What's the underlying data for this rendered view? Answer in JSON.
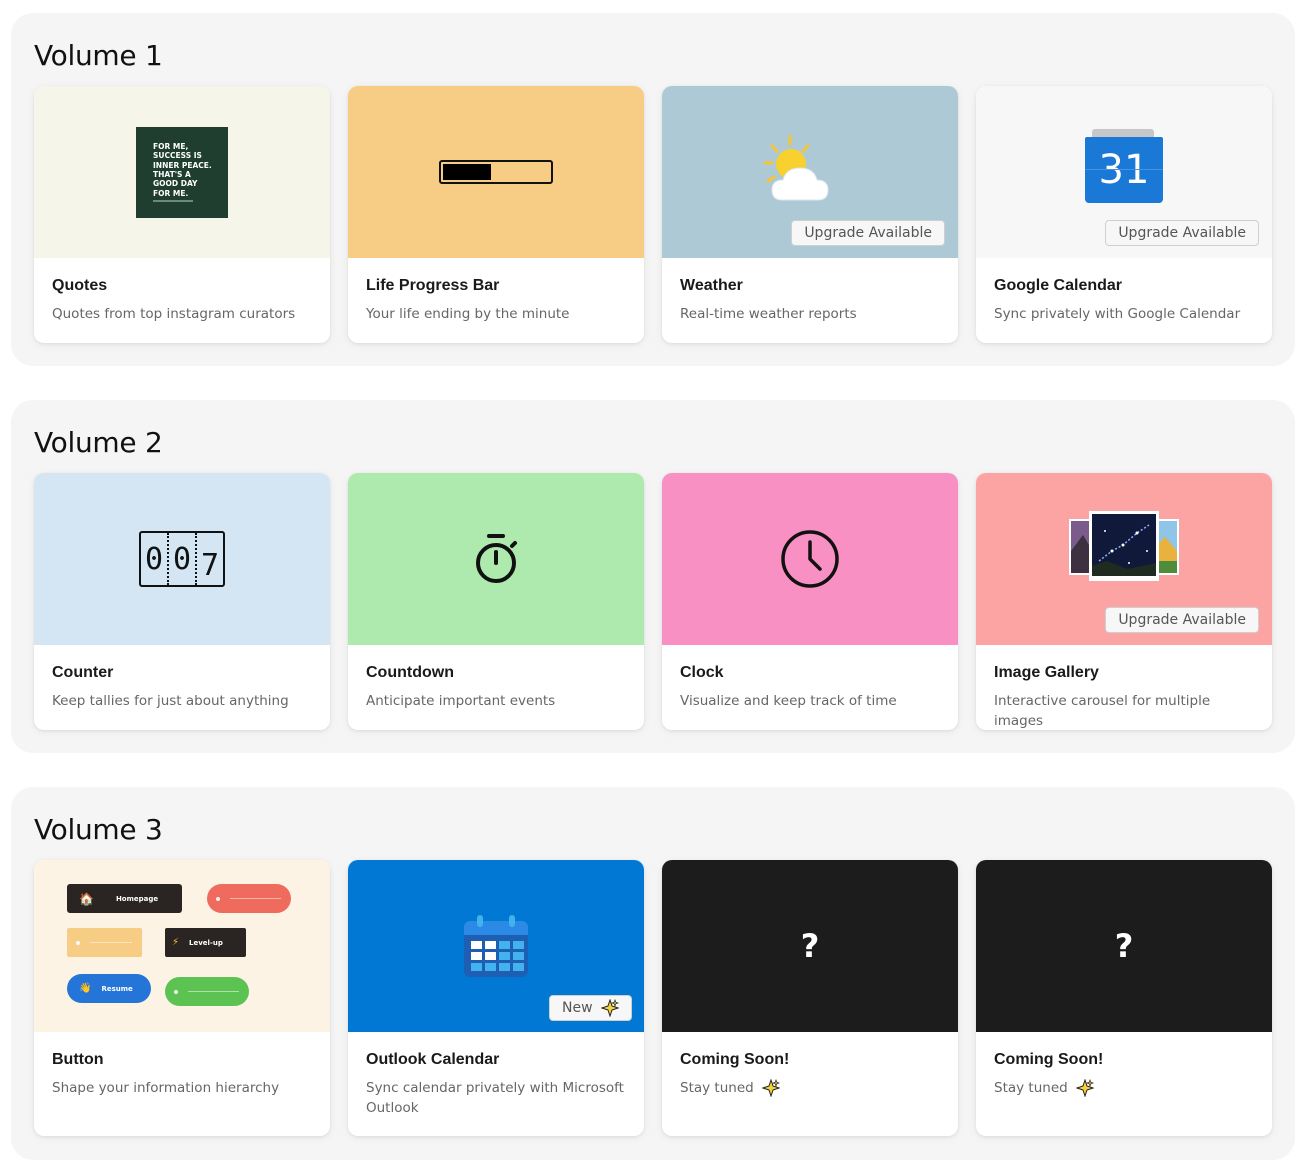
{
  "volumes": [
    {
      "title": "Volume 1",
      "cards": [
        {
          "title": "Quotes",
          "desc": "Quotes from top instagram curators",
          "quote_text": "FOR ME,\nSUCCESS IS\nINNER PEACE.\nTHAT'S A\nGOOD DAY\nFOR ME.",
          "thumb_bg": "#f5f5ea"
        },
        {
          "title": "Life Progress Bar",
          "desc": "Your life ending by the minute",
          "progress": 0.45,
          "thumb_bg": "#f7cd86"
        },
        {
          "title": "Weather",
          "desc": "Real-time weather reports",
          "badge": "Upgrade Available",
          "thumb_bg": "#aec9d6"
        },
        {
          "title": "Google Calendar",
          "desc": "Sync privately with Google Calendar",
          "badge": "Upgrade Available",
          "calendar_day": "31",
          "thumb_bg": "#f7f7f7"
        }
      ]
    },
    {
      "title": "Volume 2",
      "cards": [
        {
          "title": "Counter",
          "desc": "Keep tallies for just about anything",
          "digits": [
            "0",
            "0",
            "7"
          ],
          "thumb_bg": "#d4e6f3"
        },
        {
          "title": "Countdown",
          "desc": "Anticipate important events",
          "thumb_bg": "#aeeaae"
        },
        {
          "title": "Clock",
          "desc": "Visualize and keep track of time",
          "thumb_bg": "#f890c4"
        },
        {
          "title": "Image Gallery",
          "desc": "Interactive carousel for multiple images",
          "badge": "Upgrade Available",
          "thumb_bg": "#fca3a3"
        }
      ]
    },
    {
      "title": "Volume 3",
      "cards": [
        {
          "title": "Button",
          "desc": "Shape your information hierarchy",
          "thumb_bg": "#fdf3e5",
          "mini_buttons": {
            "homepage": "Homepage",
            "level_up": "Level-up",
            "resume": "Resume"
          }
        },
        {
          "title": "Outlook Calendar",
          "desc": "Sync calendar privately with Microsoft Outlook",
          "badge": "New",
          "thumb_bg": "#0078d4"
        },
        {
          "title": "Coming Soon!",
          "desc": "Stay tuned",
          "question": "?",
          "thumb_bg": "#1c1c1c"
        },
        {
          "title": "Coming Soon!",
          "desc": "Stay tuned",
          "question": "?",
          "thumb_bg": "#1c1c1c"
        }
      ]
    }
  ],
  "icons": {
    "sparkle": "sparkles-icon",
    "weather": "sun-cloud-icon",
    "google_calendar": "google-calendar-icon",
    "countdown": "stopwatch-icon",
    "clock": "clock-icon",
    "gallery": "photo-stack-icon",
    "outlook": "outlook-calendar-icon"
  }
}
